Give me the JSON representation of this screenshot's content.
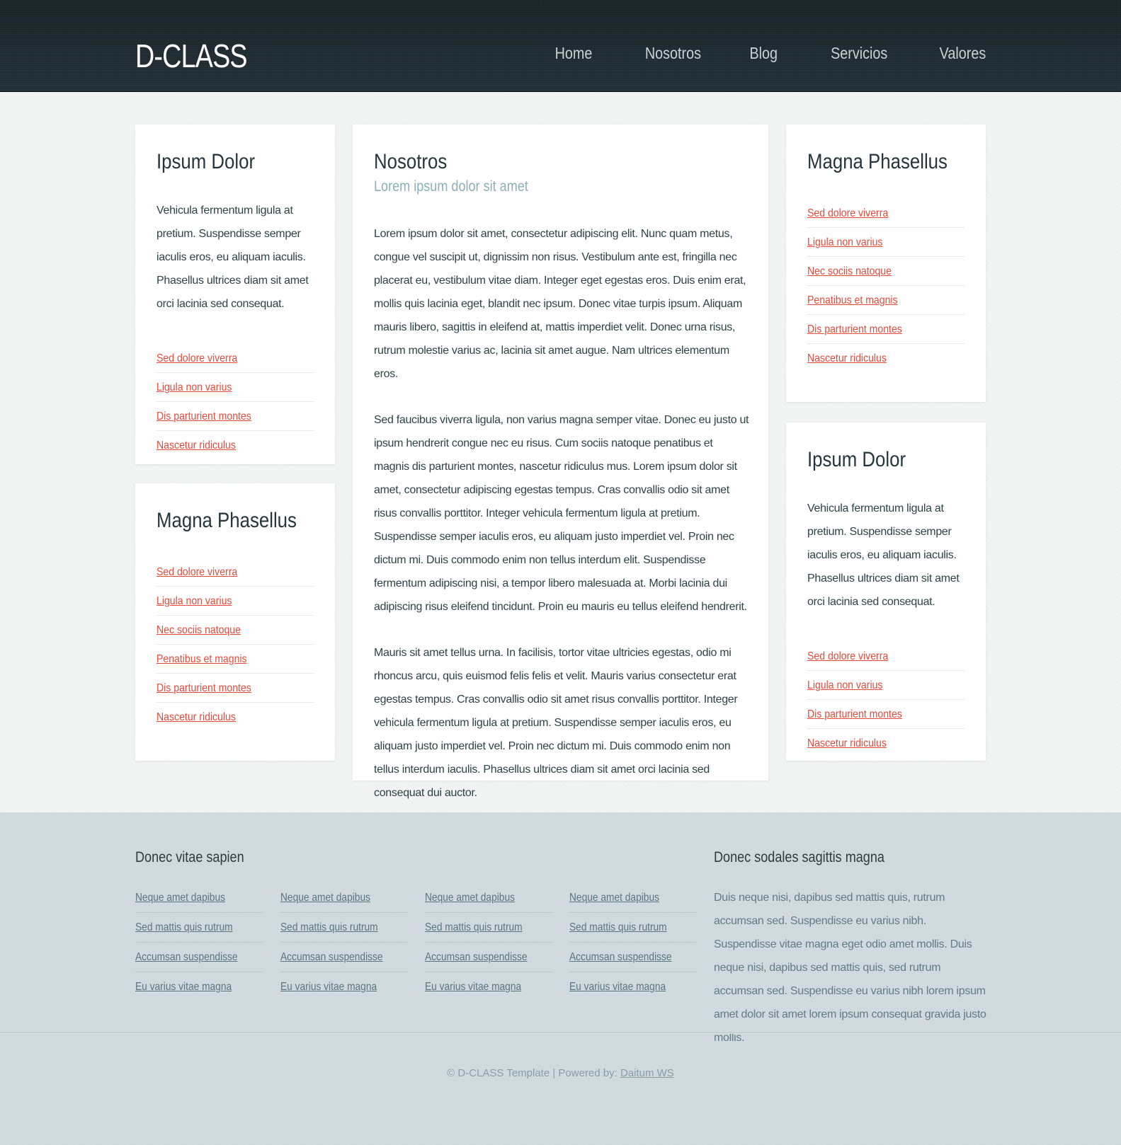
{
  "header": {
    "logo": "D-CLASS",
    "nav": [
      "Home",
      "Nosotros",
      "Blog",
      "Servicios",
      "Valores"
    ]
  },
  "left_top": {
    "title": "Ipsum Dolor",
    "text": "Vehicula fermentum ligula at pretium. Suspendisse semper iaculis eros, eu aliquam iaculis. Phasellus ultrices diam sit amet orci lacinia sed consequat.",
    "links": [
      "Sed dolore viverra",
      "Ligula non varius",
      "Dis parturient montes",
      "Nascetur ridiculus"
    ]
  },
  "left_bottom": {
    "title": "Magna Phasellus",
    "links": [
      "Sed dolore viverra",
      "Ligula non varius",
      "Nec sociis natoque",
      "Penatibus et magnis",
      "Dis parturient montes",
      "Nascetur ridiculus"
    ]
  },
  "center": {
    "title": "Nosotros",
    "subtitle": "Lorem ipsum dolor sit amet",
    "paragraphs": [
      "Lorem ipsum dolor sit amet, consectetur adipiscing elit. Nunc quam metus, congue vel suscipit ut, dignissim non risus. Vestibulum ante est, fringilla nec placerat eu, vestibulum vitae diam. Integer eget egestas eros. Duis enim erat, mollis quis lacinia eget, blandit nec ipsum. Donec vitae turpis ipsum. Aliquam mauris libero, sagittis in eleifend at, mattis imperdiet velit. Donec urna risus, rutrum molestie varius ac, lacinia sit amet augue. Nam ultrices elementum eros.",
      "Sed faucibus viverra ligula, non varius magna semper vitae. Donec eu justo ut ipsum hendrerit congue nec eu risus. Cum sociis natoque penatibus et magnis dis parturient montes, nascetur ridiculus mus. Lorem ipsum dolor sit amet, consectetur adipiscing egestas tempus. Cras convallis odio sit amet risus convallis porttitor. Integer vehicula fermentum ligula at pretium. Suspendisse semper iaculis eros, eu aliquam justo imperdiet vel. Proin nec dictum mi. Duis commodo enim non tellus interdum elit. Suspendisse fermentum adipiscing nisi, a tempor libero malesuada at. Morbi lacinia dui adipiscing risus eleifend tincidunt. Proin eu mauris eu tellus eleifend hendrerit.",
      "Mauris sit amet tellus urna. In facilisis, tortor vitae ultricies egestas, odio mi rhoncus arcu, quis euismod felis felis et velit. Mauris varius consectetur erat egestas tempus. Cras convallis odio sit amet risus convallis porttitor. Integer vehicula fermentum ligula at pretium. Suspendisse semper iaculis eros, eu aliquam justo imperdiet vel. Proin nec dictum mi. Duis commodo enim non tellus interdum iaculis. Phasellus ultrices diam sit amet orci lacinia sed consequat dui auctor."
    ]
  },
  "right_top": {
    "title": "Magna Phasellus",
    "links": [
      "Sed dolore viverra",
      "Ligula non varius",
      "Nec sociis natoque",
      "Penatibus et magnis",
      "Dis parturient montes",
      "Nascetur ridiculus"
    ]
  },
  "right_bottom": {
    "title": "Ipsum Dolor",
    "text": "Vehicula fermentum ligula at pretium. Suspendisse semper iaculis eros, eu aliquam iaculis. Phasellus ultrices diam sit amet orci lacinia sed consequat.",
    "links": [
      "Sed dolore viverra",
      "Ligula non varius",
      "Dis parturient montes",
      "Nascetur ridiculus"
    ]
  },
  "footer": {
    "left_title": "Donec vitae sapien",
    "right_title": "Donec sodales sagittis magna",
    "columns": [
      [
        "Neque amet dapibus",
        "Sed mattis quis rutrum",
        "Accumsan suspendisse",
        "Eu varius vitae magna"
      ],
      [
        "Neque amet dapibus",
        "Sed mattis quis rutrum",
        "Accumsan suspendisse",
        "Eu varius vitae magna"
      ],
      [
        "Neque amet dapibus",
        "Sed mattis quis rutrum",
        "Accumsan suspendisse",
        "Eu varius vitae magna"
      ],
      [
        "Neque amet dapibus",
        "Sed mattis quis rutrum",
        "Accumsan suspendisse",
        "Eu varius vitae magna"
      ]
    ],
    "text": "Duis neque nisi, dapibus sed mattis quis, rutrum accumsan sed. Suspendisse eu varius nibh. Suspendisse vitae magna eget odio amet mollis. Duis neque nisi, dapibus sed mattis quis, sed rutrum accumsan sed. Suspendisse eu varius nibh lorem ipsum amet dolor sit amet lorem ipsum consequat gravida justo mollis.",
    "copyright": "© D-CLASS Template | Powered by:",
    "powered_link": "Daitum WS"
  },
  "colors": {
    "header_bg": "#1f2a30",
    "link_accent": "#e84a3a",
    "subtitle": "#8ab0b8",
    "footer_bg": "#cfd9de"
  }
}
